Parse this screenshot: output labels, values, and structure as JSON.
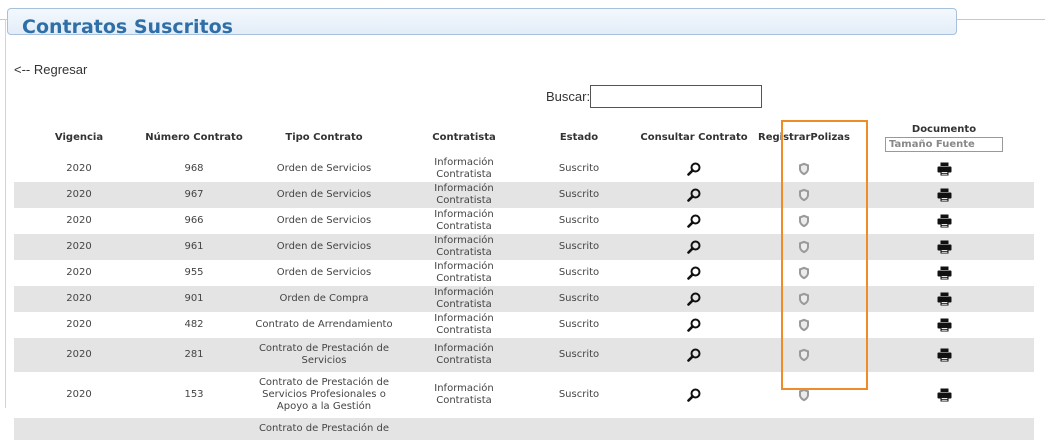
{
  "page": {
    "title": "Contratos Suscritos",
    "back_link": "<-- Regresar",
    "search_label": "Buscar:",
    "search_value": ""
  },
  "table": {
    "headers": {
      "vigencia": "Vigencia",
      "numero": "Número Contrato",
      "tipo": "Tipo Contrato",
      "contratista": "Contratista",
      "estado": "Estado",
      "consultar": "Consultar Contrato",
      "registrar": "RegistrarPolizas",
      "documento": "Documento",
      "font_size_placeholder": "Tamaño Fuente"
    },
    "rows": [
      {
        "vigencia": "2020",
        "numero": "968",
        "tipo": "Orden de Servicios",
        "contratista": "Información Contratista",
        "estado": "Suscrito"
      },
      {
        "vigencia": "2020",
        "numero": "967",
        "tipo": "Orden de Servicios",
        "contratista": "Información Contratista",
        "estado": "Suscrito"
      },
      {
        "vigencia": "2020",
        "numero": "966",
        "tipo": "Orden de Servicios",
        "contratista": "Información Contratista",
        "estado": "Suscrito"
      },
      {
        "vigencia": "2020",
        "numero": "961",
        "tipo": "Orden de Servicios",
        "contratista": "Información Contratista",
        "estado": "Suscrito"
      },
      {
        "vigencia": "2020",
        "numero": "955",
        "tipo": "Orden de Servicios",
        "contratista": "Información Contratista",
        "estado": "Suscrito"
      },
      {
        "vigencia": "2020",
        "numero": "901",
        "tipo": "Orden de Compra",
        "contratista": "Información Contratista",
        "estado": "Suscrito"
      },
      {
        "vigencia": "2020",
        "numero": "482",
        "tipo": "Contrato de Arrendamiento",
        "contratista": "Información Contratista",
        "estado": "Suscrito"
      },
      {
        "vigencia": "2020",
        "numero": "281",
        "tipo": "Contrato de Prestación de Servicios",
        "contratista": "Información Contratista",
        "estado": "Suscrito"
      },
      {
        "vigencia": "2020",
        "numero": "153",
        "tipo": "Contrato de Prestación de Servicios Profesionales o Apoyo a la Gestión",
        "contratista": "Información Contratista",
        "estado": "Suscrito"
      }
    ],
    "partial_row_text": "Contrato de Prestación de"
  },
  "icons": {
    "consultar": "magnifier-icon",
    "registrar": "shield-icon",
    "documento": "printer-icon"
  },
  "colors": {
    "title": "#2f6fa7",
    "highlight": "#f08c27",
    "row_alt": "#e4e4e4"
  }
}
